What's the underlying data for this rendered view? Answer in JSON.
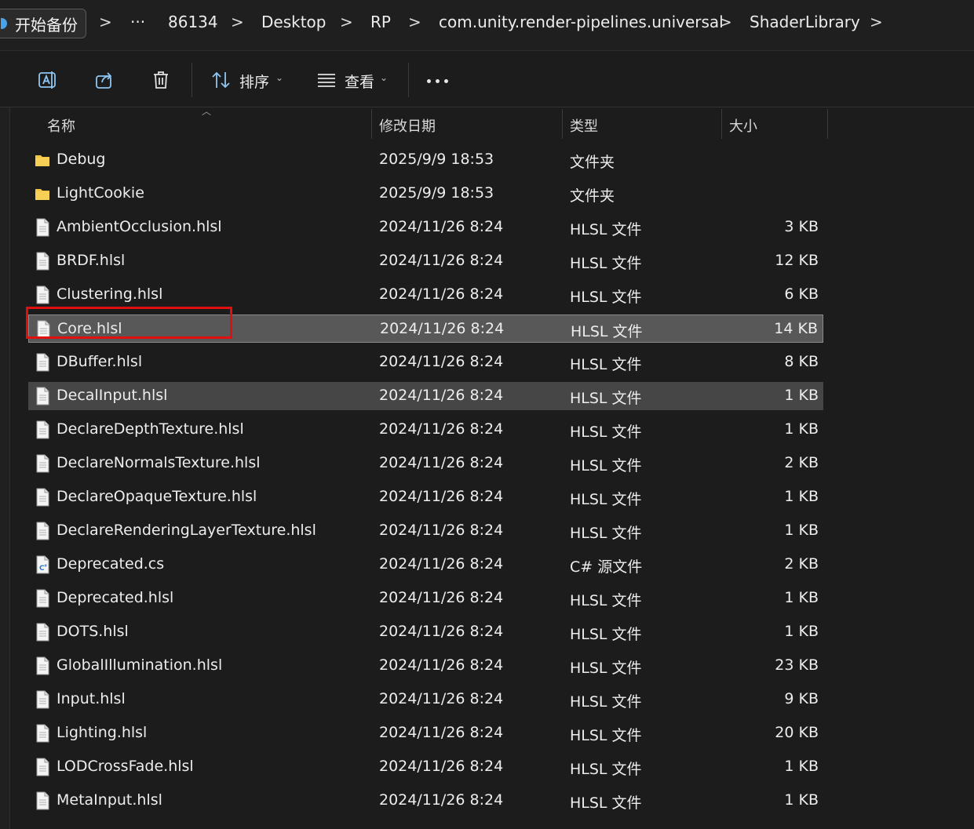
{
  "breadcrumb": {
    "start_label": "开始备份",
    "overflow": "···",
    "items": [
      "86134",
      "Desktop",
      "RP",
      "com.unity.render-pipelines.universal",
      "ShaderLibrary"
    ],
    "separator": ">"
  },
  "toolbar": {
    "sort_label": "排序",
    "view_label": "查看",
    "caret": "⌄"
  },
  "columns": {
    "name": "名称",
    "date": "修改日期",
    "type": "类型",
    "size": "大小"
  },
  "files": [
    {
      "name": "Debug",
      "date": "2025/9/9 18:53",
      "type": "文件夹",
      "size": "",
      "icon": "folder-icon"
    },
    {
      "name": "LightCookie",
      "date": "2025/9/9 18:53",
      "type": "文件夹",
      "size": "",
      "icon": "folder-icon"
    },
    {
      "name": "AmbientOcclusion.hlsl",
      "date": "2024/11/26 8:24",
      "type": "HLSL 文件",
      "size": "3 KB",
      "icon": "file-icon"
    },
    {
      "name": "BRDF.hlsl",
      "date": "2024/11/26 8:24",
      "type": "HLSL 文件",
      "size": "12 KB",
      "icon": "file-icon"
    },
    {
      "name": "Clustering.hlsl",
      "date": "2024/11/26 8:24",
      "type": "HLSL 文件",
      "size": "6 KB",
      "icon": "file-icon"
    },
    {
      "name": "Core.hlsl",
      "date": "2024/11/26 8:24",
      "type": "HLSL 文件",
      "size": "14 KB",
      "icon": "file-icon"
    },
    {
      "name": "DBuffer.hlsl",
      "date": "2024/11/26 8:24",
      "type": "HLSL 文件",
      "size": "8 KB",
      "icon": "file-icon"
    },
    {
      "name": "DecalInput.hlsl",
      "date": "2024/11/26 8:24",
      "type": "HLSL 文件",
      "size": "1 KB",
      "icon": "file-icon"
    },
    {
      "name": "DeclareDepthTexture.hlsl",
      "date": "2024/11/26 8:24",
      "type": "HLSL 文件",
      "size": "1 KB",
      "icon": "file-icon"
    },
    {
      "name": "DeclareNormalsTexture.hlsl",
      "date": "2024/11/26 8:24",
      "type": "HLSL 文件",
      "size": "2 KB",
      "icon": "file-icon"
    },
    {
      "name": "DeclareOpaqueTexture.hlsl",
      "date": "2024/11/26 8:24",
      "type": "HLSL 文件",
      "size": "1 KB",
      "icon": "file-icon"
    },
    {
      "name": "DeclareRenderingLayerTexture.hlsl",
      "date": "2024/11/26 8:24",
      "type": "HLSL 文件",
      "size": "1 KB",
      "icon": "file-icon"
    },
    {
      "name": "Deprecated.cs",
      "date": "2024/11/26 8:24",
      "type": "C# 源文件",
      "size": "2 KB",
      "icon": "csharp-file-icon"
    },
    {
      "name": "Deprecated.hlsl",
      "date": "2024/11/26 8:24",
      "type": "HLSL 文件",
      "size": "1 KB",
      "icon": "file-icon"
    },
    {
      "name": "DOTS.hlsl",
      "date": "2024/11/26 8:24",
      "type": "HLSL 文件",
      "size": "1 KB",
      "icon": "file-icon"
    },
    {
      "name": "GlobalIllumination.hlsl",
      "date": "2024/11/26 8:24",
      "type": "HLSL 文件",
      "size": "23 KB",
      "icon": "file-icon"
    },
    {
      "name": "Input.hlsl",
      "date": "2024/11/26 8:24",
      "type": "HLSL 文件",
      "size": "9 KB",
      "icon": "file-icon"
    },
    {
      "name": "Lighting.hlsl",
      "date": "2024/11/26 8:24",
      "type": "HLSL 文件",
      "size": "20 KB",
      "icon": "file-icon"
    },
    {
      "name": "LODCrossFade.hlsl",
      "date": "2024/11/26 8:24",
      "type": "HLSL 文件",
      "size": "1 KB",
      "icon": "file-icon"
    },
    {
      "name": "MetaInput.hlsl",
      "date": "2024/11/26 8:24",
      "type": "HLSL 文件",
      "size": "1 KB",
      "icon": "file-icon"
    }
  ],
  "selected_file": "Core.hlsl",
  "hovered_file": "DecalInput.hlsl",
  "colors": {
    "background": "#1c1c1c",
    "selected_row": "#585858",
    "hover_row": "#464646",
    "folder": "#f3c542",
    "annotation_box": "#e01010"
  }
}
